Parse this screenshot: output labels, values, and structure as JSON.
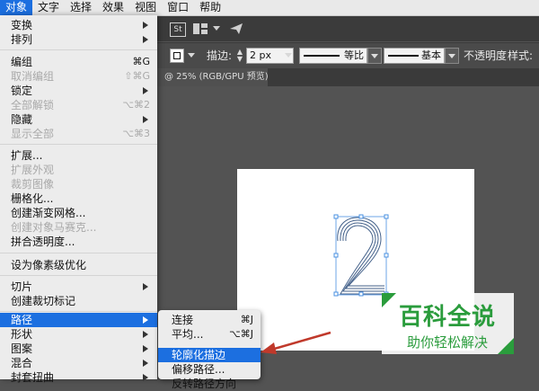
{
  "menubar": {
    "items": [
      "对象",
      "文字",
      "选择",
      "效果",
      "视图",
      "窗口",
      "帮助"
    ],
    "active_index": 0
  },
  "app_toolbar": {
    "st_badge": "St"
  },
  "control_bar": {
    "stroke_label": "描边:",
    "stroke_value": "2 px",
    "profile_label": "等比",
    "brush_label": "基本",
    "opacity_label": "不透明度",
    "style_label": "样式:"
  },
  "document_tab": {
    "title": "@ 25% (RGB/GPU 预览)"
  },
  "object_menu": {
    "items": [
      {
        "label": "变换",
        "shortcut": "",
        "submenu": true,
        "disabled": false
      },
      {
        "label": "排列",
        "shortcut": "",
        "submenu": true,
        "disabled": false
      },
      {
        "label": "编组",
        "shortcut": "⌘G",
        "submenu": false,
        "disabled": false
      },
      {
        "label": "取消编组",
        "shortcut": "⇧⌘G",
        "submenu": false,
        "disabled": true
      },
      {
        "label": "锁定",
        "shortcut": "",
        "submenu": true,
        "disabled": false
      },
      {
        "label": "全部解锁",
        "shortcut": "⌥⌘2",
        "submenu": false,
        "disabled": true
      },
      {
        "label": "隐藏",
        "shortcut": "",
        "submenu": true,
        "disabled": false
      },
      {
        "label": "显示全部",
        "shortcut": "⌥⌘3",
        "submenu": false,
        "disabled": true
      },
      {
        "label": "扩展...",
        "shortcut": "",
        "submenu": false,
        "disabled": false
      },
      {
        "label": "扩展外观",
        "shortcut": "",
        "submenu": false,
        "disabled": true
      },
      {
        "label": "裁剪图像",
        "shortcut": "",
        "submenu": false,
        "disabled": true
      },
      {
        "label": "栅格化...",
        "shortcut": "",
        "submenu": false,
        "disabled": false
      },
      {
        "label": "创建渐变网格...",
        "shortcut": "",
        "submenu": false,
        "disabled": false
      },
      {
        "label": "创建对象马赛克...",
        "shortcut": "",
        "submenu": false,
        "disabled": true
      },
      {
        "label": "拼合透明度...",
        "shortcut": "",
        "submenu": false,
        "disabled": false
      },
      {
        "label": "设为像素级优化",
        "shortcut": "",
        "submenu": false,
        "disabled": false
      },
      {
        "label": "切片",
        "shortcut": "",
        "submenu": true,
        "disabled": false
      },
      {
        "label": "创建裁切标记",
        "shortcut": "",
        "submenu": false,
        "disabled": false
      },
      {
        "label": "路径",
        "shortcut": "",
        "submenu": true,
        "disabled": false,
        "highlighted": true
      },
      {
        "label": "形状",
        "shortcut": "",
        "submenu": true,
        "disabled": false
      },
      {
        "label": "图案",
        "shortcut": "",
        "submenu": true,
        "disabled": false
      },
      {
        "label": "混合",
        "shortcut": "",
        "submenu": true,
        "disabled": false
      },
      {
        "label": "封套扭曲",
        "shortcut": "",
        "submenu": true,
        "disabled": false
      }
    ]
  },
  "path_submenu": {
    "items": [
      {
        "label": "连接",
        "shortcut": "⌘J"
      },
      {
        "label": "平均...",
        "shortcut": "⌥⌘J"
      },
      {
        "label": "轮廓化描边",
        "shortcut": "",
        "highlighted": true
      },
      {
        "label": "偏移路径...",
        "shortcut": ""
      },
      {
        "label": "反转路径方向",
        "shortcut": ""
      }
    ]
  },
  "watermark": {
    "title": "百科全说",
    "subtitle": "助你轻松解决"
  },
  "colors": {
    "menu_highlight": "#1c6fe0",
    "watermark_green": "#2a9c3c",
    "annotation_arrow": "#c0392b",
    "selection_blue": "#4a90e2"
  }
}
